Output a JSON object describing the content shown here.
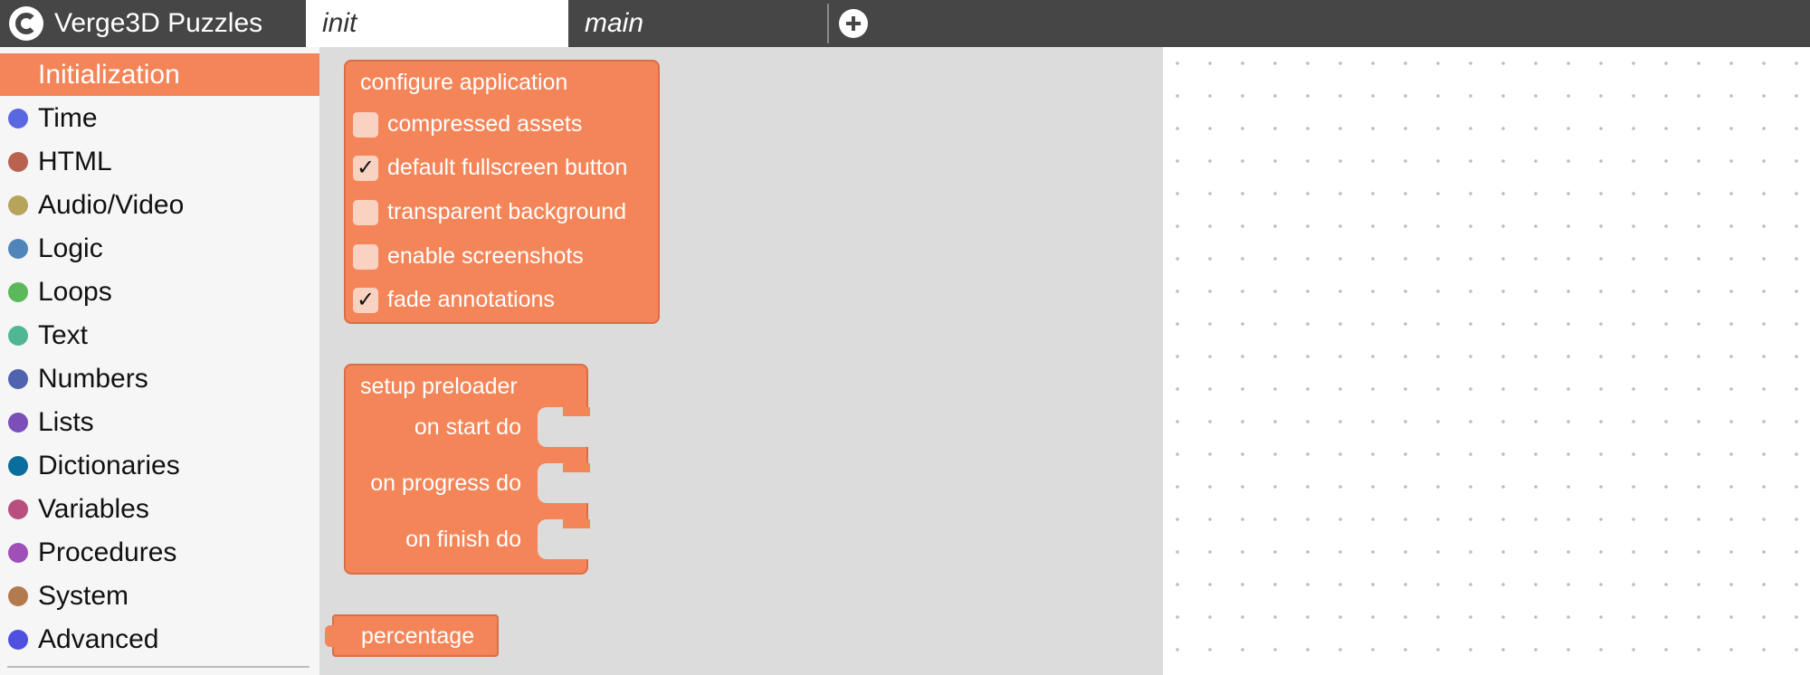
{
  "app": {
    "title": "Verge3D Puzzles",
    "logo_icon": "verge3d-logo-icon"
  },
  "tabs": [
    {
      "label": "init",
      "active": true
    },
    {
      "label": "main",
      "active": false
    }
  ],
  "add_tab_icon": "plus-circle-icon",
  "sidebar": {
    "items": [
      {
        "label": "Initialization",
        "color": "#f48559",
        "active": true
      },
      {
        "label": "Time",
        "color": "#5b67e0"
      },
      {
        "label": "HTML",
        "color": "#b8624f"
      },
      {
        "label": "Audio/Video",
        "color": "#b7a45b"
      },
      {
        "label": "Logic",
        "color": "#4f85b8"
      },
      {
        "label": "Loops",
        "color": "#5bb85b"
      },
      {
        "label": "Text",
        "color": "#4fb893"
      },
      {
        "label": "Numbers",
        "color": "#4f63b0"
      },
      {
        "label": "Lists",
        "color": "#7a4fb8"
      },
      {
        "label": "Dictionaries",
        "color": "#0a6e9c"
      },
      {
        "label": "Variables",
        "color": "#b84f7f"
      },
      {
        "label": "Procedures",
        "color": "#a04fb8"
      },
      {
        "label": "System",
        "color": "#b37a4f"
      },
      {
        "label": "Advanced",
        "color": "#4f4fe0"
      }
    ]
  },
  "blocks": {
    "configure": {
      "title": "configure application",
      "options": [
        {
          "label": "compressed assets",
          "checked": false,
          "mark": ""
        },
        {
          "label": "default fullscreen button",
          "checked": true,
          "mark": "✓"
        },
        {
          "label": "transparent background",
          "checked": false,
          "mark": ""
        },
        {
          "label": "enable screenshots",
          "checked": false,
          "mark": ""
        },
        {
          "label": "fade annotations",
          "checked": true,
          "mark": "✓"
        }
      ]
    },
    "preloader": {
      "title": "setup preloader",
      "slots": [
        "on start do",
        "on progress do",
        "on finish do"
      ]
    },
    "percentage": {
      "label": "percentage"
    }
  },
  "colors": {
    "block": "#f48559",
    "topbar": "#464646",
    "flyout": "#dcdcdc"
  }
}
